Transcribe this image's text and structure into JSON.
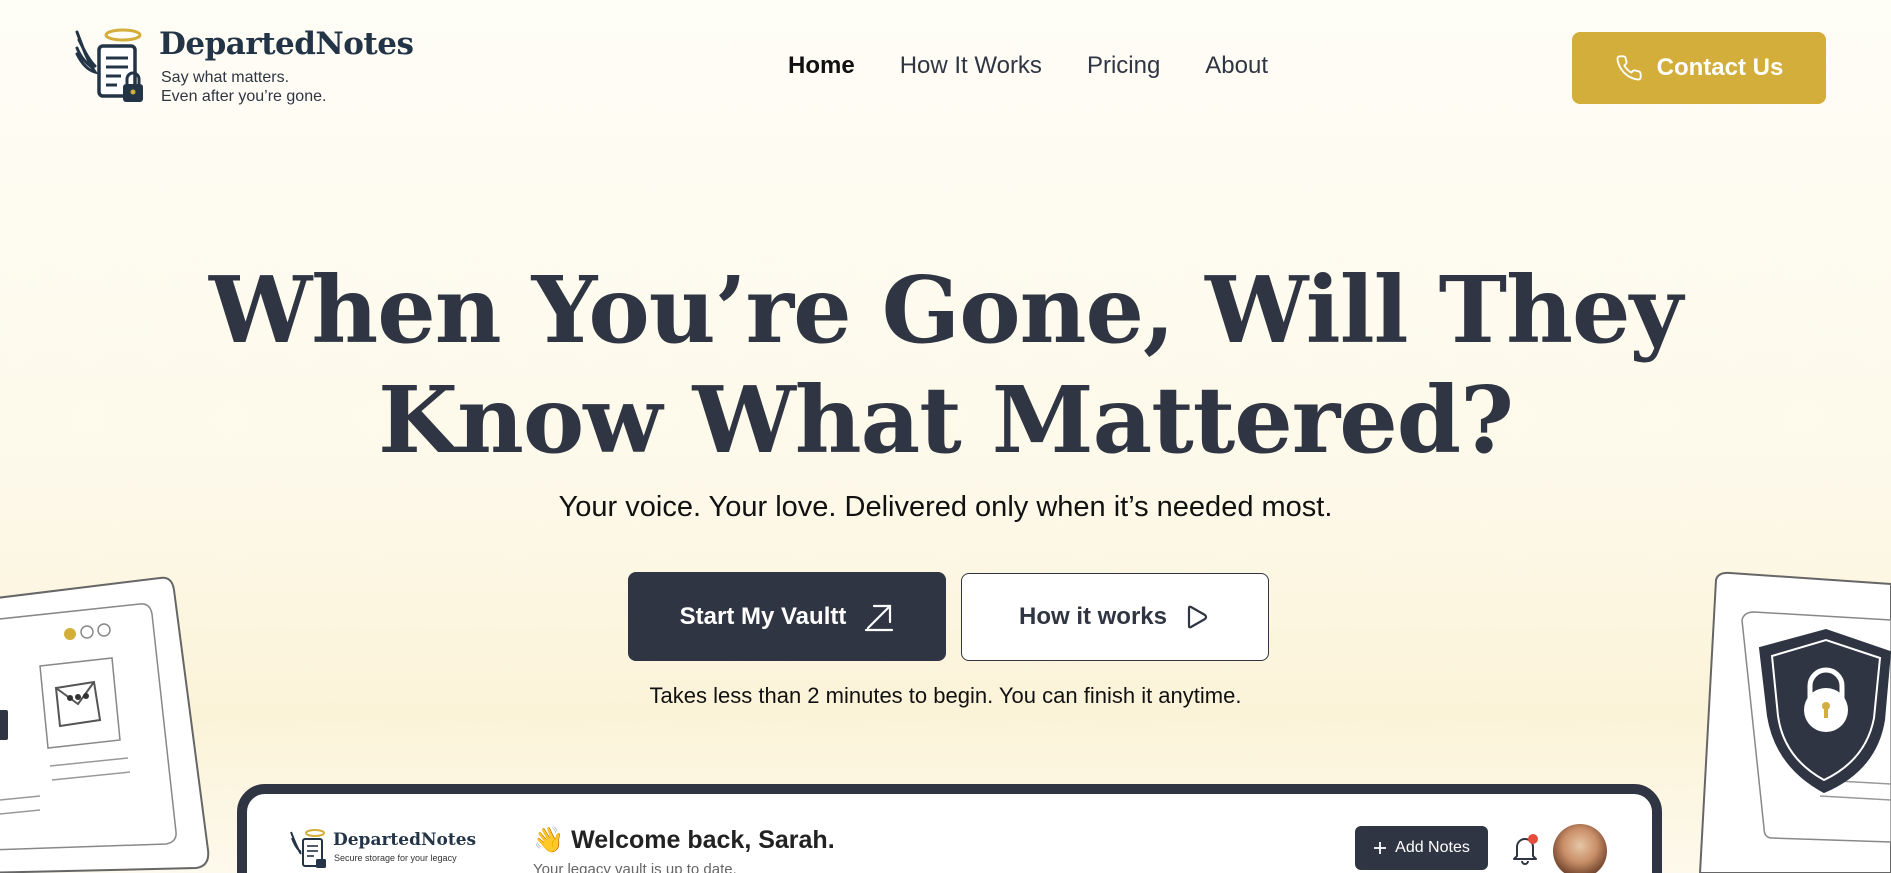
{
  "brand": {
    "name": "DepartedNotes",
    "tagline_line1": "Say what matters.",
    "tagline_line2": "Even after you’re gone.",
    "accent": "#d3ae3a",
    "dark": "#2f3542"
  },
  "nav": {
    "items": [
      {
        "label": "Home",
        "active": true
      },
      {
        "label": "How It Works",
        "active": false
      },
      {
        "label": "Pricing",
        "active": false
      },
      {
        "label": "About",
        "active": false
      }
    ],
    "contact_label": "Contact Us",
    "contact_icon": "phone-icon"
  },
  "hero": {
    "title_line1": "When You’re Gone, Will They",
    "title_line2": "Know What Mattered?",
    "subtitle": "Your voice. Your love. Delivered only when it’s needed most.",
    "primary_cta": "Start My Vaultt",
    "primary_icon": "arrow-up-right-icon",
    "secondary_cta": "How it works",
    "secondary_icon": "play-icon",
    "note": "Takes less than 2 minutes to begin. You can finish it anytime."
  },
  "preview": {
    "logo_name": "DepartedNotes",
    "logo_tag": "Secure storage for your legacy",
    "welcome": "Welcome back, Sarah.",
    "welcome_emoji": "👋",
    "status": "Your legacy vault is up to date.",
    "add_button": "Add Notes",
    "add_icon": "plus-icon",
    "bell_icon": "bell-icon",
    "notification_dot_color": "#e74c3c"
  }
}
